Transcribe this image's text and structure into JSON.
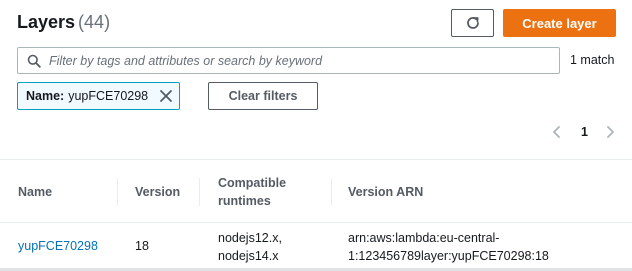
{
  "header": {
    "title": "Layers",
    "count": "(44)",
    "create_label": "Create layer",
    "refresh_icon": "refresh-icon"
  },
  "filter": {
    "placeholder": "Filter by tags and attributes or search by keyword",
    "match_text": "1 match",
    "token_key": "Name:",
    "token_value": "yupFCE70298",
    "clear_label": "Clear filters"
  },
  "pagination": {
    "page": "1"
  },
  "table": {
    "headers": {
      "name": "Name",
      "version": "Version",
      "runtimes_line1": "Compatible",
      "runtimes_line2": "runtimes",
      "arn": "Version ARN"
    },
    "rows": [
      {
        "name": "yupFCE70298",
        "version": "18",
        "runtime1": "nodejs12.x,",
        "runtime2": "nodejs14.x",
        "arn_line1": "arn:aws:lambda:eu-central-",
        "arn_line2": "1:123456789layer:yupFCE70298:18"
      }
    ]
  },
  "colors": {
    "accent": "#ec7211",
    "link": "#0073bb",
    "token_border": "#00a1c9"
  }
}
